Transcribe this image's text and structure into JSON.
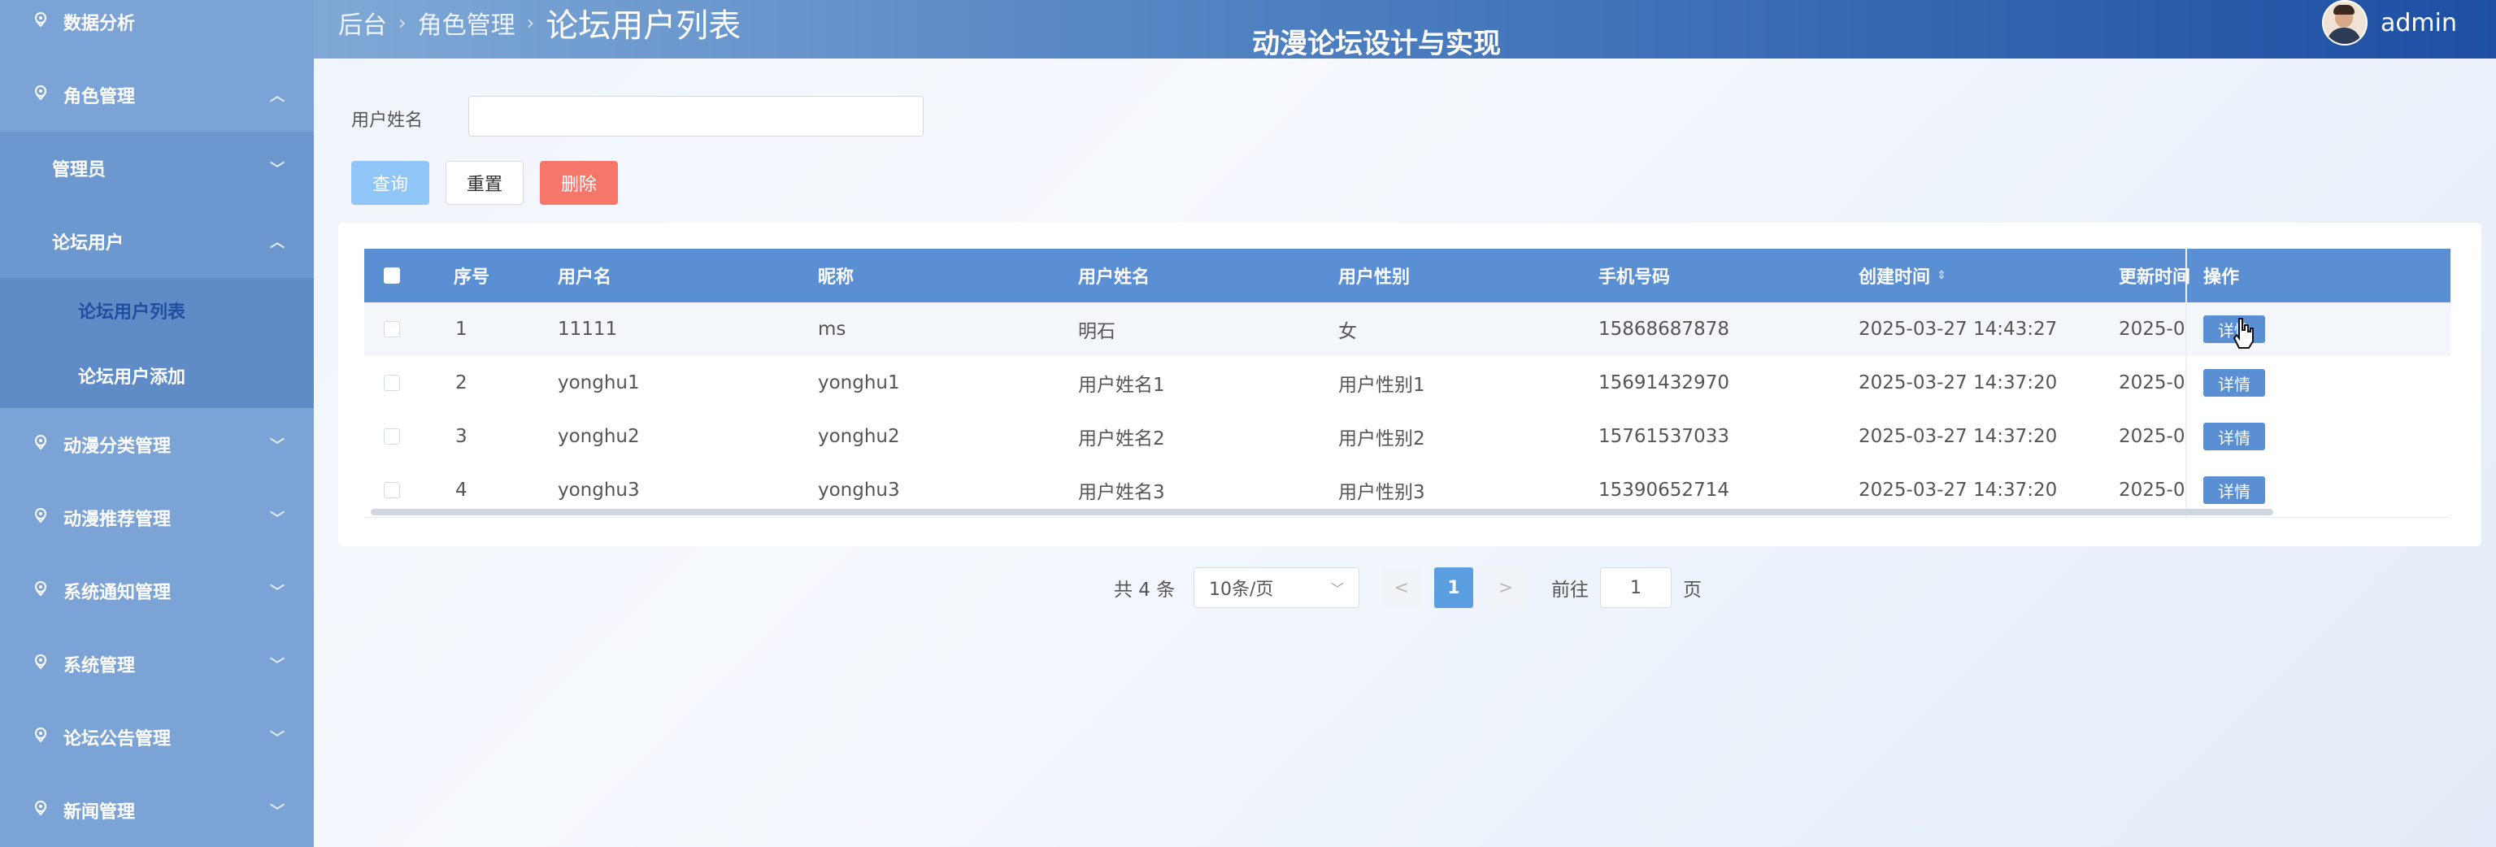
{
  "header": {
    "breadcrumb": [
      "后台",
      "角色管理"
    ],
    "current": "论坛用户列表",
    "site_title": "动漫论坛设计与实现",
    "username": "admin"
  },
  "sidebar": {
    "items": [
      {
        "label": "数据分析",
        "chevron": ""
      },
      {
        "label": "角色管理",
        "chevron": "^"
      },
      {
        "label": "管理员",
        "chevron": "v"
      },
      {
        "label": "论坛用户",
        "chevron": "^"
      },
      {
        "label": "论坛用户列表"
      },
      {
        "label": "论坛用户添加"
      },
      {
        "label": "动漫分类管理",
        "chevron": "v"
      },
      {
        "label": "动漫推荐管理",
        "chevron": "v"
      },
      {
        "label": "系统通知管理",
        "chevron": "v"
      },
      {
        "label": "系统管理",
        "chevron": "v"
      },
      {
        "label": "论坛公告管理",
        "chevron": "v"
      },
      {
        "label": "新闻管理",
        "chevron": "v"
      }
    ]
  },
  "search": {
    "label": "用户姓名",
    "value": "",
    "query_label": "查询",
    "reset_label": "重置",
    "delete_label": "删除"
  },
  "table": {
    "headers": [
      "序号",
      "用户名",
      "昵称",
      "用户姓名",
      "用户性别",
      "手机号码",
      "创建时间",
      "更新时间",
      "操作"
    ],
    "sort_icon": "sort-icon",
    "rows": [
      {
        "index": "1",
        "username": "11111",
        "nickname": "ms",
        "realname": "明石",
        "gender": "女",
        "phone": "15868687878",
        "created": "2025-03-27 14:43:27",
        "updated": "2025-0..",
        "action": "详情"
      },
      {
        "index": "2",
        "username": "yonghu1",
        "nickname": "yonghu1",
        "realname": "用户姓名1",
        "gender": "用户性别1",
        "phone": "15691432970",
        "created": "2025-03-27 14:37:20",
        "updated": "2025-0..",
        "action": "详情"
      },
      {
        "index": "3",
        "username": "yonghu2",
        "nickname": "yonghu2",
        "realname": "用户姓名2",
        "gender": "用户性别2",
        "phone": "15761537033",
        "created": "2025-03-27 14:37:20",
        "updated": "2025-0..",
        "action": "详情"
      },
      {
        "index": "4",
        "username": "yonghu3",
        "nickname": "yonghu3",
        "realname": "用户姓名3",
        "gender": "用户性别3",
        "phone": "15390652714",
        "created": "2025-03-27 14:37:20",
        "updated": "2025-0..",
        "action": "详情"
      }
    ]
  },
  "pagination": {
    "total": "共 4 条",
    "page_size": "10条/页",
    "prev": "<",
    "current_page": "1",
    "next": ">",
    "goto_prefix": "前往",
    "goto_value": "1",
    "goto_suffix": "页"
  },
  "colors": {
    "header_start": "#7fa8d6",
    "header_end": "#1e4fa3",
    "sidebar": "#7ba3d6",
    "table_header": "#5b8fd4",
    "delete": "#f7766a",
    "query": "#8fc5f7"
  }
}
